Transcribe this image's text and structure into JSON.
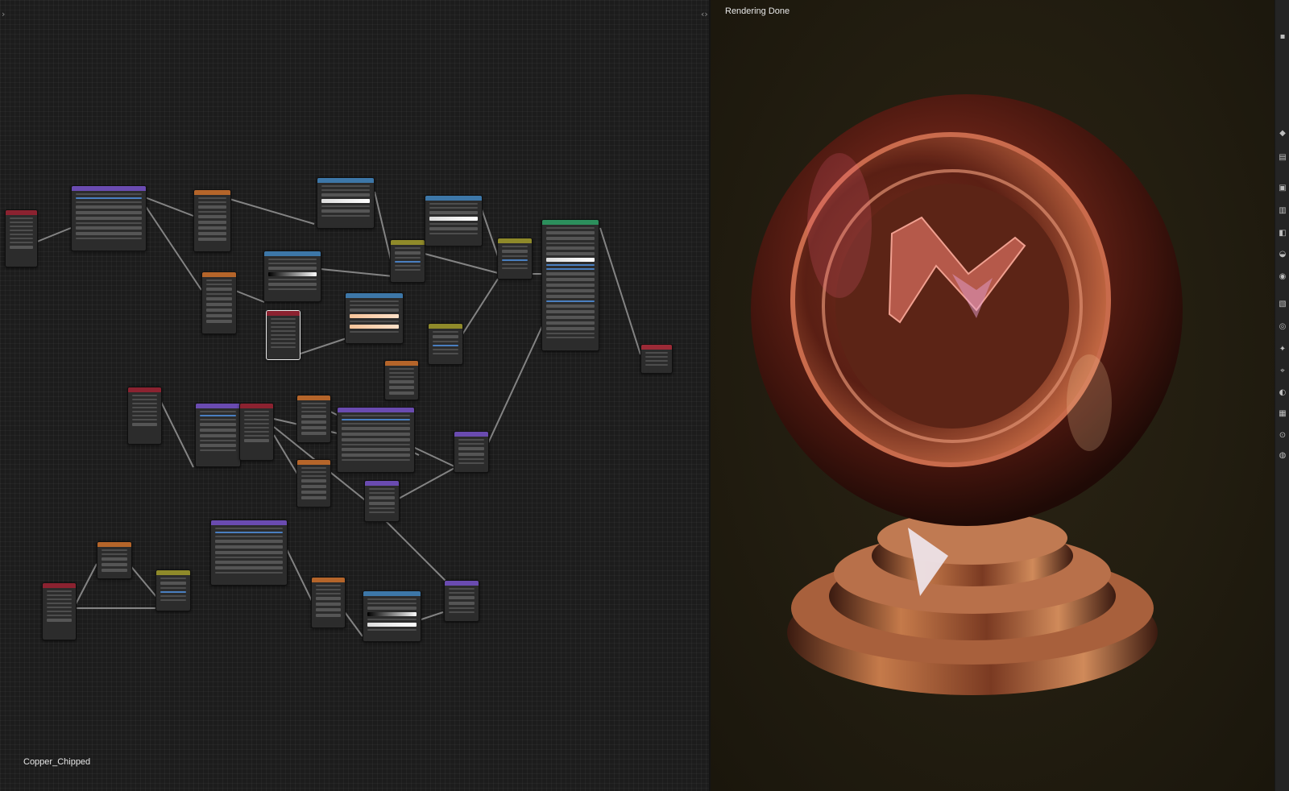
{
  "node_editor": {
    "material_name": "Copper_Chipped"
  },
  "render_view": {
    "status": "Rendering Done"
  },
  "toolbar_icons": [
    "view-icon",
    "tool-icon",
    "render-icon",
    "output-icon",
    "view-layer-icon",
    "scene-icon",
    "world-icon",
    "object-icon",
    "modifier-icon",
    "particles-icon",
    "physics-icon",
    "constraints-icon",
    "data-icon",
    "material-icon",
    "texture-icon"
  ],
  "colors": {
    "editor_bg": "#1c1c1c",
    "render_bg": "#221d10",
    "node_header_texcoord": "#8b2230",
    "node_header_mapping": "#6a4bb0",
    "node_header_texture": "#b5652a",
    "node_header_colorramp": "#3d77a8",
    "node_header_mix": "#8f8a2a",
    "node_header_shader": "#2c8f5c",
    "copper": "#b4573a"
  }
}
